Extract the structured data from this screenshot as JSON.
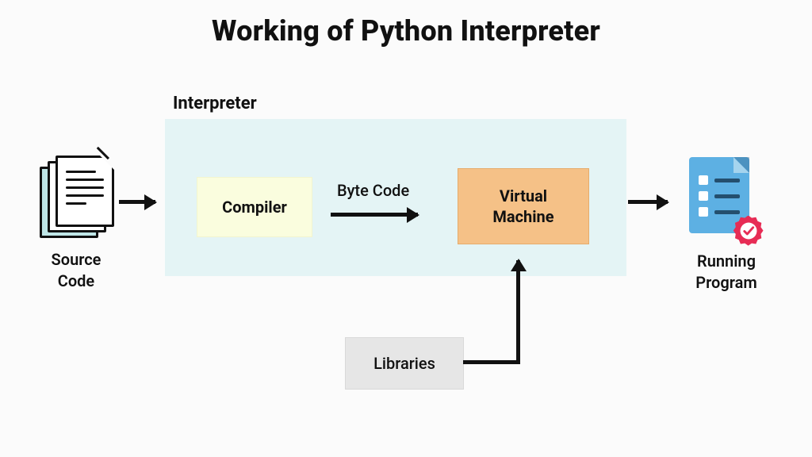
{
  "title": "Working of Python Interpreter",
  "interpreter_label": "Interpreter",
  "source_label": "Source\nCode",
  "compiler_label": "Compiler",
  "bytecode_label": "Byte Code",
  "vm_label": "Virtual\nMachine",
  "running_label": "Running\nProgram",
  "libraries_label": "Libraries",
  "flow": [
    {
      "from": "source-code",
      "to": "compiler"
    },
    {
      "from": "compiler",
      "to": "virtual-machine",
      "edge_label": "Byte Code"
    },
    {
      "from": "virtual-machine",
      "to": "running-program"
    },
    {
      "from": "libraries",
      "to": "virtual-machine"
    }
  ],
  "colors": {
    "interpreter_bg": "#e4f4f5",
    "compiler_bg": "#fafdde",
    "vm_bg": "#f5c187",
    "libraries_bg": "#e6e6e6",
    "doc_accent": "#bfe6e7",
    "clipboard": "#5db0e3",
    "seal": "#e72c55"
  }
}
